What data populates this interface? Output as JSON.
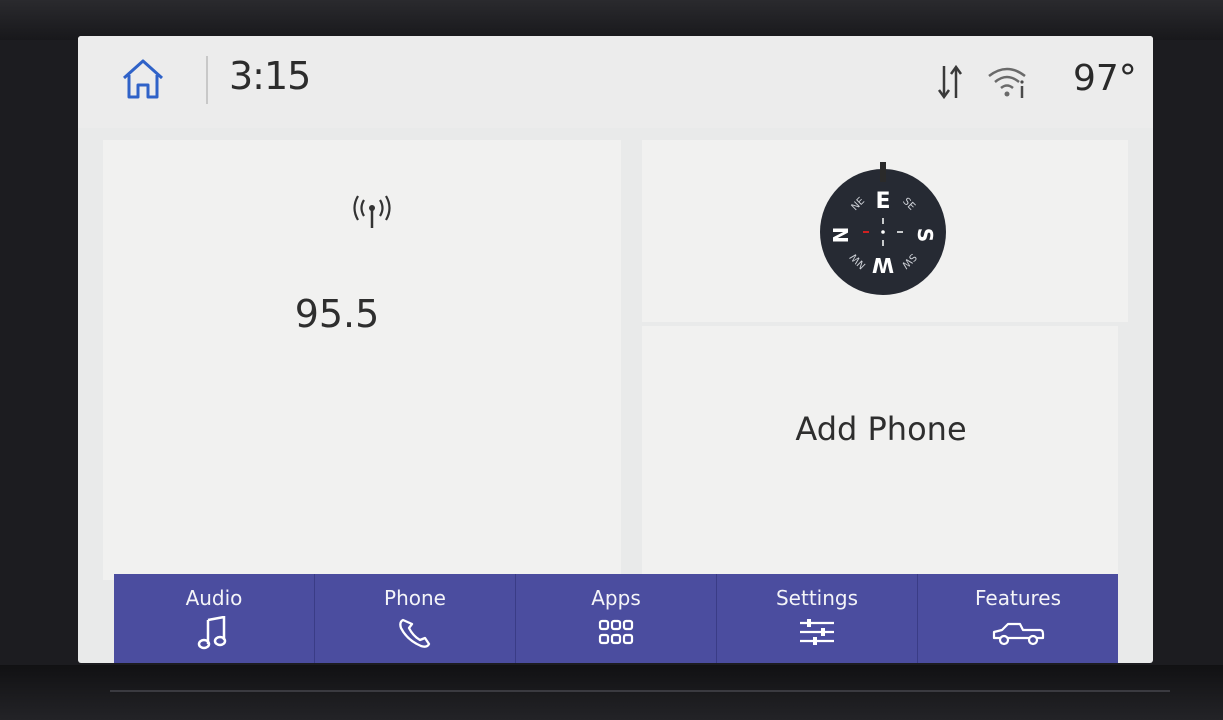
{
  "status_bar": {
    "time": "3:15",
    "temperature": "97°",
    "icons": [
      "home-icon",
      "data-transfer-icon",
      "wifi-icon"
    ]
  },
  "radio_tile": {
    "icon": "radio-antenna-icon",
    "frequency": "95.5"
  },
  "compass_tile": {
    "heading": "E",
    "labels": {
      "north": "N",
      "east": "E",
      "south": "S",
      "west": "W",
      "ne": "NE",
      "se": "SE",
      "sw": "SW",
      "nw": "NW"
    }
  },
  "phone_tile": {
    "label": "Add Phone"
  },
  "nav": {
    "items": [
      {
        "label": "Audio",
        "icon": "music-note-icon"
      },
      {
        "label": "Phone",
        "icon": "phone-icon"
      },
      {
        "label": "Apps",
        "icon": "apps-grid-icon"
      },
      {
        "label": "Settings",
        "icon": "sliders-icon"
      },
      {
        "label": "Features",
        "icon": "truck-icon"
      }
    ]
  },
  "colors": {
    "nav_background": "#4b4d9f",
    "screen_background": "#e9eaea",
    "home_icon": "#2f62c8",
    "compass_red": "#d02020"
  }
}
